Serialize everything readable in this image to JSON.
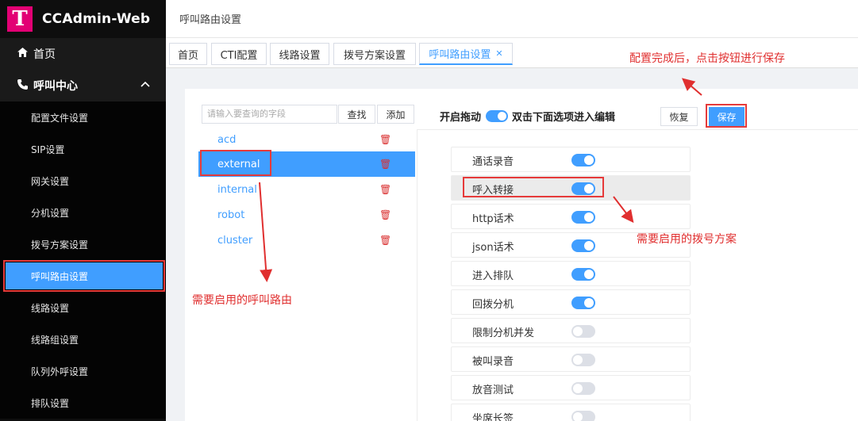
{
  "app": {
    "title": "CCAdmin-Web",
    "logo_letter": "T",
    "brand_color": "#e20074",
    "accent": "#409eff"
  },
  "sidebar": {
    "home": "首页",
    "group": "呼叫中心",
    "items": [
      {
        "label": "配置文件设置"
      },
      {
        "label": "SIP设置"
      },
      {
        "label": "网关设置"
      },
      {
        "label": "分机设置"
      },
      {
        "label": "拨号方案设置"
      },
      {
        "label": "呼叫路由设置",
        "active": true
      },
      {
        "label": "线路设置"
      },
      {
        "label": "线路组设置"
      },
      {
        "label": "队列外呼设置"
      },
      {
        "label": "排队设置"
      }
    ]
  },
  "header": {
    "title": "呼叫路由设置"
  },
  "tabs": [
    "首页",
    "CTI配置",
    "线路设置",
    "拨号方案设置",
    "呼叫路由设置"
  ],
  "toolbar": {
    "search_placeholder": "请输入要查询的字段",
    "search_btn": "查找",
    "add_btn": "添加",
    "drag_label": "开启拖动",
    "drag_hint": "双击下面选项进入编辑",
    "restore_btn": "恢复",
    "save_btn": "保存"
  },
  "routes": [
    "acd",
    "external",
    "internal",
    "robot",
    "cluster"
  ],
  "options": [
    {
      "label": "通话录音",
      "on": true
    },
    {
      "label": "呼入转接",
      "on": true
    },
    {
      "label": "http话术",
      "on": true
    },
    {
      "label": "json话术",
      "on": true
    },
    {
      "label": "进入排队",
      "on": true
    },
    {
      "label": "回拨分机",
      "on": true
    },
    {
      "label": "限制分机并发",
      "on": false
    },
    {
      "label": "被叫录音",
      "on": false
    },
    {
      "label": "放音测试",
      "on": false
    },
    {
      "label": "坐席长签",
      "on": false
    }
  ],
  "annotations": {
    "save": "配置完成后，点击按钮进行保存",
    "route": "需要启用的呼叫路由",
    "dialplan": "需要启用的拨号方案"
  }
}
